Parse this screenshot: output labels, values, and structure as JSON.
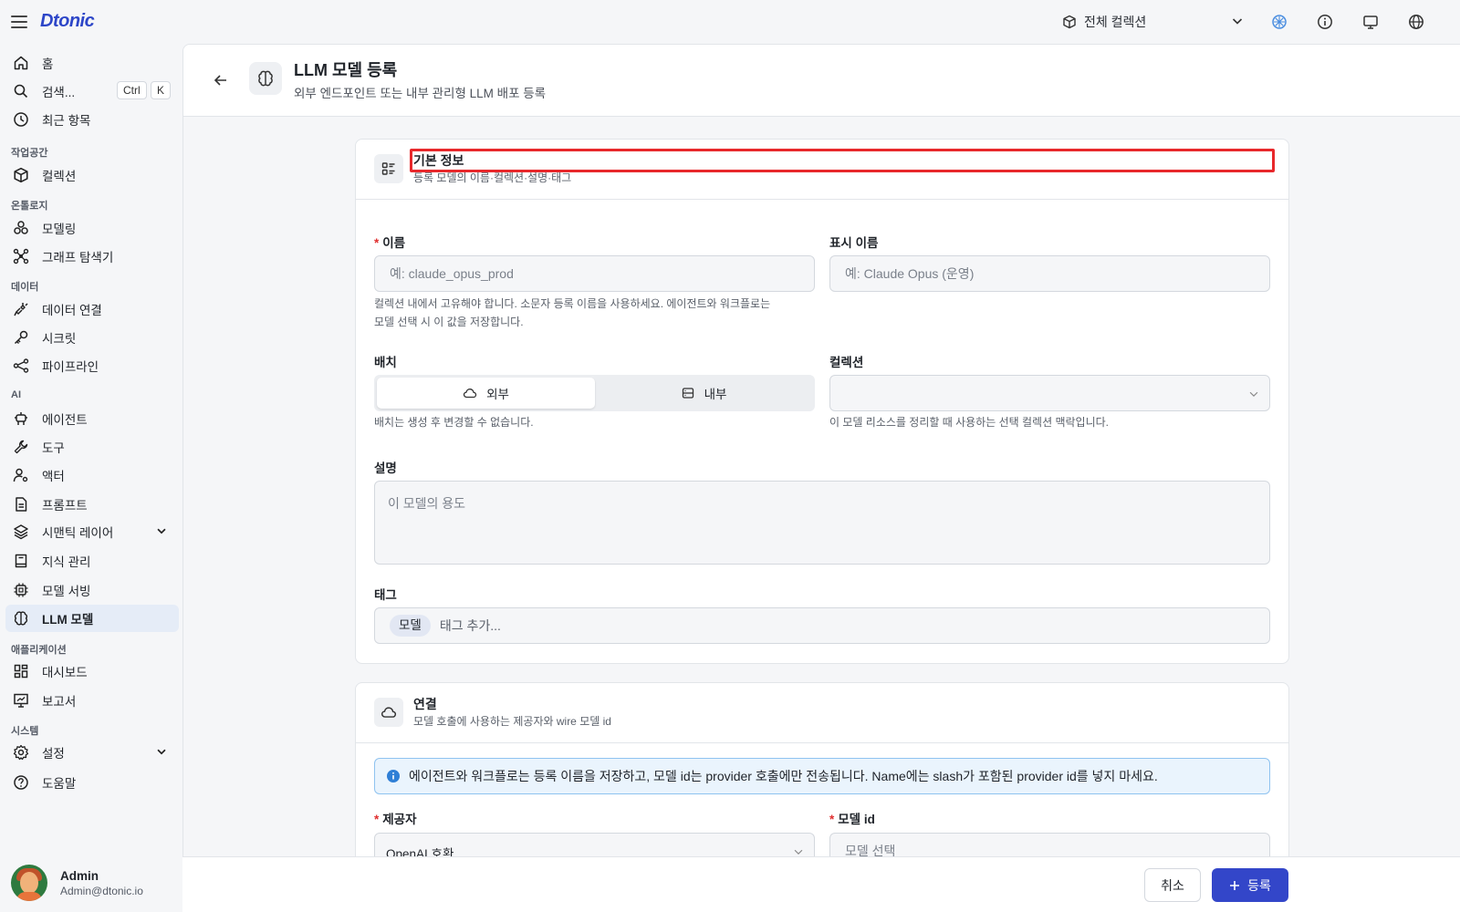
{
  "app": {
    "logo": "Dtonic"
  },
  "topbar": {
    "collection_label": "전체 컬렉션"
  },
  "sidebar": {
    "home": "홈",
    "search": "검색...",
    "search_kbd_1": "Ctrl",
    "search_kbd_2": "K",
    "recent": "최근 항목",
    "sections": {
      "workspace": "작업공간",
      "ontology": "온톨로지",
      "data": "데이터",
      "ai": "AI",
      "apps": "애플리케이션",
      "system": "시스템"
    },
    "items": {
      "collections": "컬렉션",
      "modeling": "모델링",
      "graph_explorer": "그래프 탐색기",
      "data_connection": "데이터 연결",
      "secrets": "시크릿",
      "pipelines": "파이프라인",
      "agents": "에이전트",
      "tools": "도구",
      "actors": "액터",
      "prompts": "프롬프트",
      "semantic_layer": "시맨틱 레이어",
      "knowledge": "지식 관리",
      "model_serving": "모델 서빙",
      "llm_models": "LLM 모델",
      "dashboards": "대시보드",
      "reports": "보고서",
      "settings": "설정",
      "help": "도움말"
    },
    "user": {
      "name": "Admin",
      "email": "Admin@dtonic.io"
    }
  },
  "page": {
    "title": "LLM 모델 등록",
    "subtitle": "외부 엔드포인트 또는 내부 관리형 LLM 배포 등록"
  },
  "basic_info": {
    "title": "기본 정보",
    "subtitle": "등록 모델의 이름·컬렉션·설명·태그",
    "name_label": "이름",
    "name_placeholder": "예: claude_opus_prod",
    "name_help_1": "컬렉션 내에서 고유해야 합니다. 소문자 등록 이름을 사용하세요. 에이전트와 워크플로는",
    "name_help_2": "모델 선택 시 이 값을 저장합니다.",
    "display_label": "표시 이름",
    "display_placeholder": "예: Claude Opus (운영)",
    "deploy_label": "배치",
    "deploy_external": "외부",
    "deploy_internal": "내부",
    "deploy_help": "배치는 생성 후 변경할 수 없습니다.",
    "collection_label": "컬렉션",
    "collection_help": "이 모델 리소스를 정리할 때 사용하는 선택 컬렉션 맥락입니다.",
    "desc_label": "설명",
    "desc_placeholder": "이 모델의 용도",
    "tags_label": "태그",
    "tag_chip": "모델",
    "tag_placeholder": "태그 추가..."
  },
  "connection": {
    "title": "연결",
    "subtitle": "모델 호출에 사용하는 제공자와 wire 모델 id",
    "info": "에이전트와 워크플로는 등록 이름을 저장하고, 모델 id는 provider 호출에만 전송됩니다. Name에는 slash가 포함된 provider id를 넣지 마세요.",
    "provider_label": "제공자",
    "provider_value": "OpenAI 호환",
    "model_id_label": "모델 id",
    "model_id_placeholder": "모델 선택"
  },
  "footer": {
    "cancel": "취소",
    "submit": "등록"
  },
  "colors": {
    "accent": "#3346c9",
    "highlight": "#e8282b",
    "required": "#e03030"
  }
}
